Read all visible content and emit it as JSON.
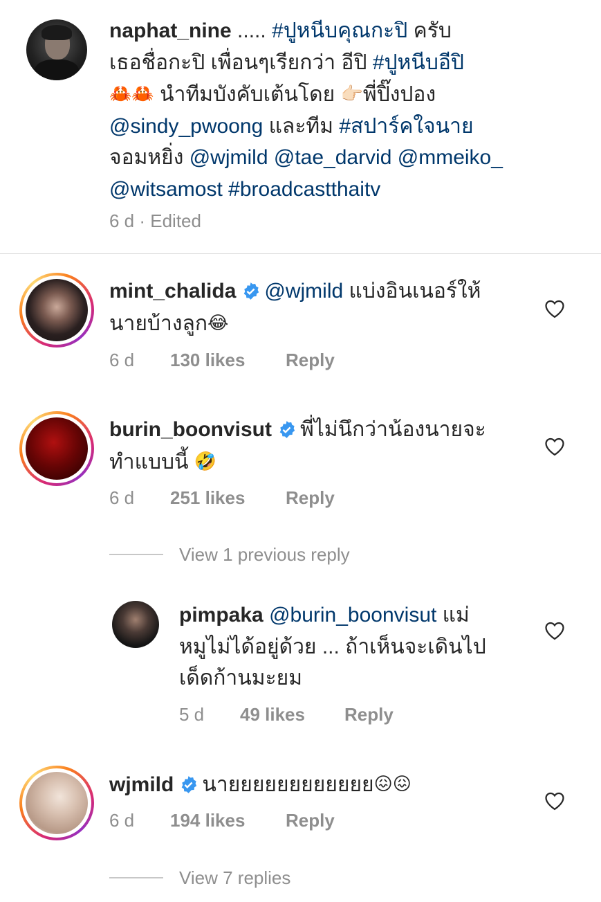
{
  "caption": {
    "username": "naphat_nine",
    "line1_rest": " ..... ",
    "tag_pu": "#ปูหนีบคุณกะปิ",
    "line1_end": " ครับ",
    "line2": "เธอชื่อกะปิ เพื่อนๆเรียกว่า อีปิ ",
    "tag_pu2": "#ปูหนีบอีปิ",
    "emoji_crabs": "🦀🦀",
    "line3": " นำทีมบังคับเต้นโดย ",
    "emoji_point": "👉🏻",
    "line3_end": "พี่ปิ๊งปอง",
    "mention_sindy": "@sindy_pwoong",
    "line4_mid": " และทีม ",
    "tag_spark": "#สปาร์คใจนาย",
    "line5_start": "จอมหยิ่ง  ",
    "mention_wjmild": "@wjmild",
    "mention_tae": "@tae_darvid",
    "mention_mmeiko": "@mmeiko_",
    "mention_wit": "@witsamost",
    "tag_broadcast": "#broadcastthaitv",
    "meta": "6 d · Edited"
  },
  "comments": [
    {
      "username": "mint_chalida",
      "mention": "@wjmild",
      "text1": " แบ่งอินเนอร์ให้",
      "text2": "นายบ้างลูก",
      "emoji": "😂",
      "time": "6 d",
      "likes": "130 likes",
      "reply": "Reply"
    },
    {
      "username": "burin_boonvisut",
      "text1": "พี่ไม่นึกว่าน้องนายจะ",
      "text2": "ทำแบบนี้ ",
      "emoji": "🤣",
      "time": "6 d",
      "likes": "251 likes",
      "reply": "Reply"
    },
    {
      "username": "wjmild",
      "text1": "นายยยยยยยยยยยย",
      "emoji": "😖😖",
      "time": "6 d",
      "likes": "194 likes",
      "reply": "Reply"
    }
  ],
  "view_previous": "View 1 previous reply",
  "reply": {
    "username": "pimpaka",
    "mention": "@burin_boonvisut",
    "text1": "  แม่",
    "text2": "หมูไม่ได้อยู่ด้วย ... ถ้าเห็นจะเดินไป",
    "text3": "เด็ดก้านมะยม",
    "time": "5 d",
    "likes": "49 likes",
    "reply": "Reply"
  },
  "view_replies": "View 7 replies",
  "colors": {
    "link": "#00376b",
    "verified": "#3897f0",
    "meta": "#8e8e8e"
  }
}
